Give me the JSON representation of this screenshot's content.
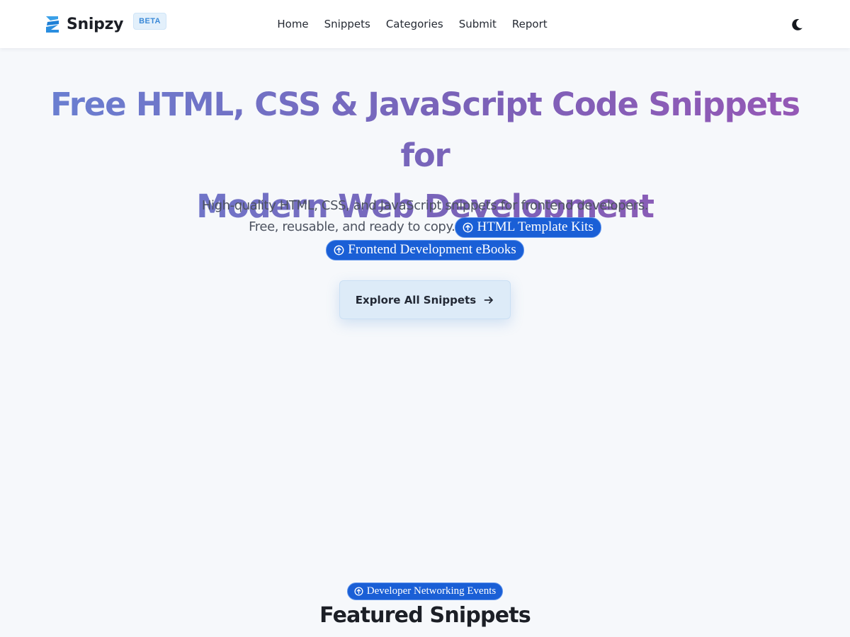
{
  "brand": {
    "name": "Snipzy",
    "badge": "BETA",
    "logo_icon": "snipzy-logo-icon"
  },
  "nav": {
    "items": [
      "Home",
      "Snippets",
      "Categories",
      "Submit",
      "Report"
    ]
  },
  "theme_toggle": {
    "icon": "moon-icon"
  },
  "hero": {
    "title_line1": "Free HTML, CSS & JavaScript Code Snippets for",
    "title_line2": "Modern Web Development",
    "desc_line1": "High-quality HTML, CSS, and JavaScript snippets for frontend developers.",
    "desc_line2": "Free, reusable, and ready to copy.",
    "promo_links": [
      "HTML Template Kits",
      "Frontend Development eBooks"
    ],
    "cta_label": "Explore All Snippets",
    "cta_icon": "arrow-right-icon"
  },
  "bottom_promo": "Developer Networking Events",
  "featured": {
    "title": "Featured Snippets"
  },
  "colors": {
    "accent_blue": "#1a5fd6",
    "title_gradient_start": "#6a7fd1",
    "title_gradient_end": "#9558b6",
    "beta_badge_bg": "#e3f0fb",
    "page_bg": "#f6f8fb"
  }
}
